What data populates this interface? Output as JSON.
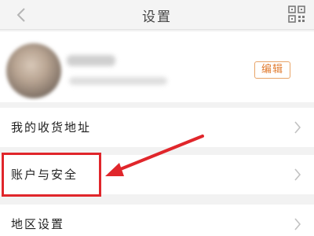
{
  "header": {
    "title": "设置",
    "back_icon": "chevron-left-icon",
    "qr_icon": "qr-code-icon"
  },
  "profile": {
    "edit_label": "编辑",
    "accent_color": "#e07a2e"
  },
  "rows": [
    {
      "label": "我的收货地址"
    },
    {
      "label": "账户与安全"
    },
    {
      "label": "地区设置"
    }
  ],
  "annotation": {
    "color": "#e0262b",
    "highlighted_item": "账户与安全"
  }
}
